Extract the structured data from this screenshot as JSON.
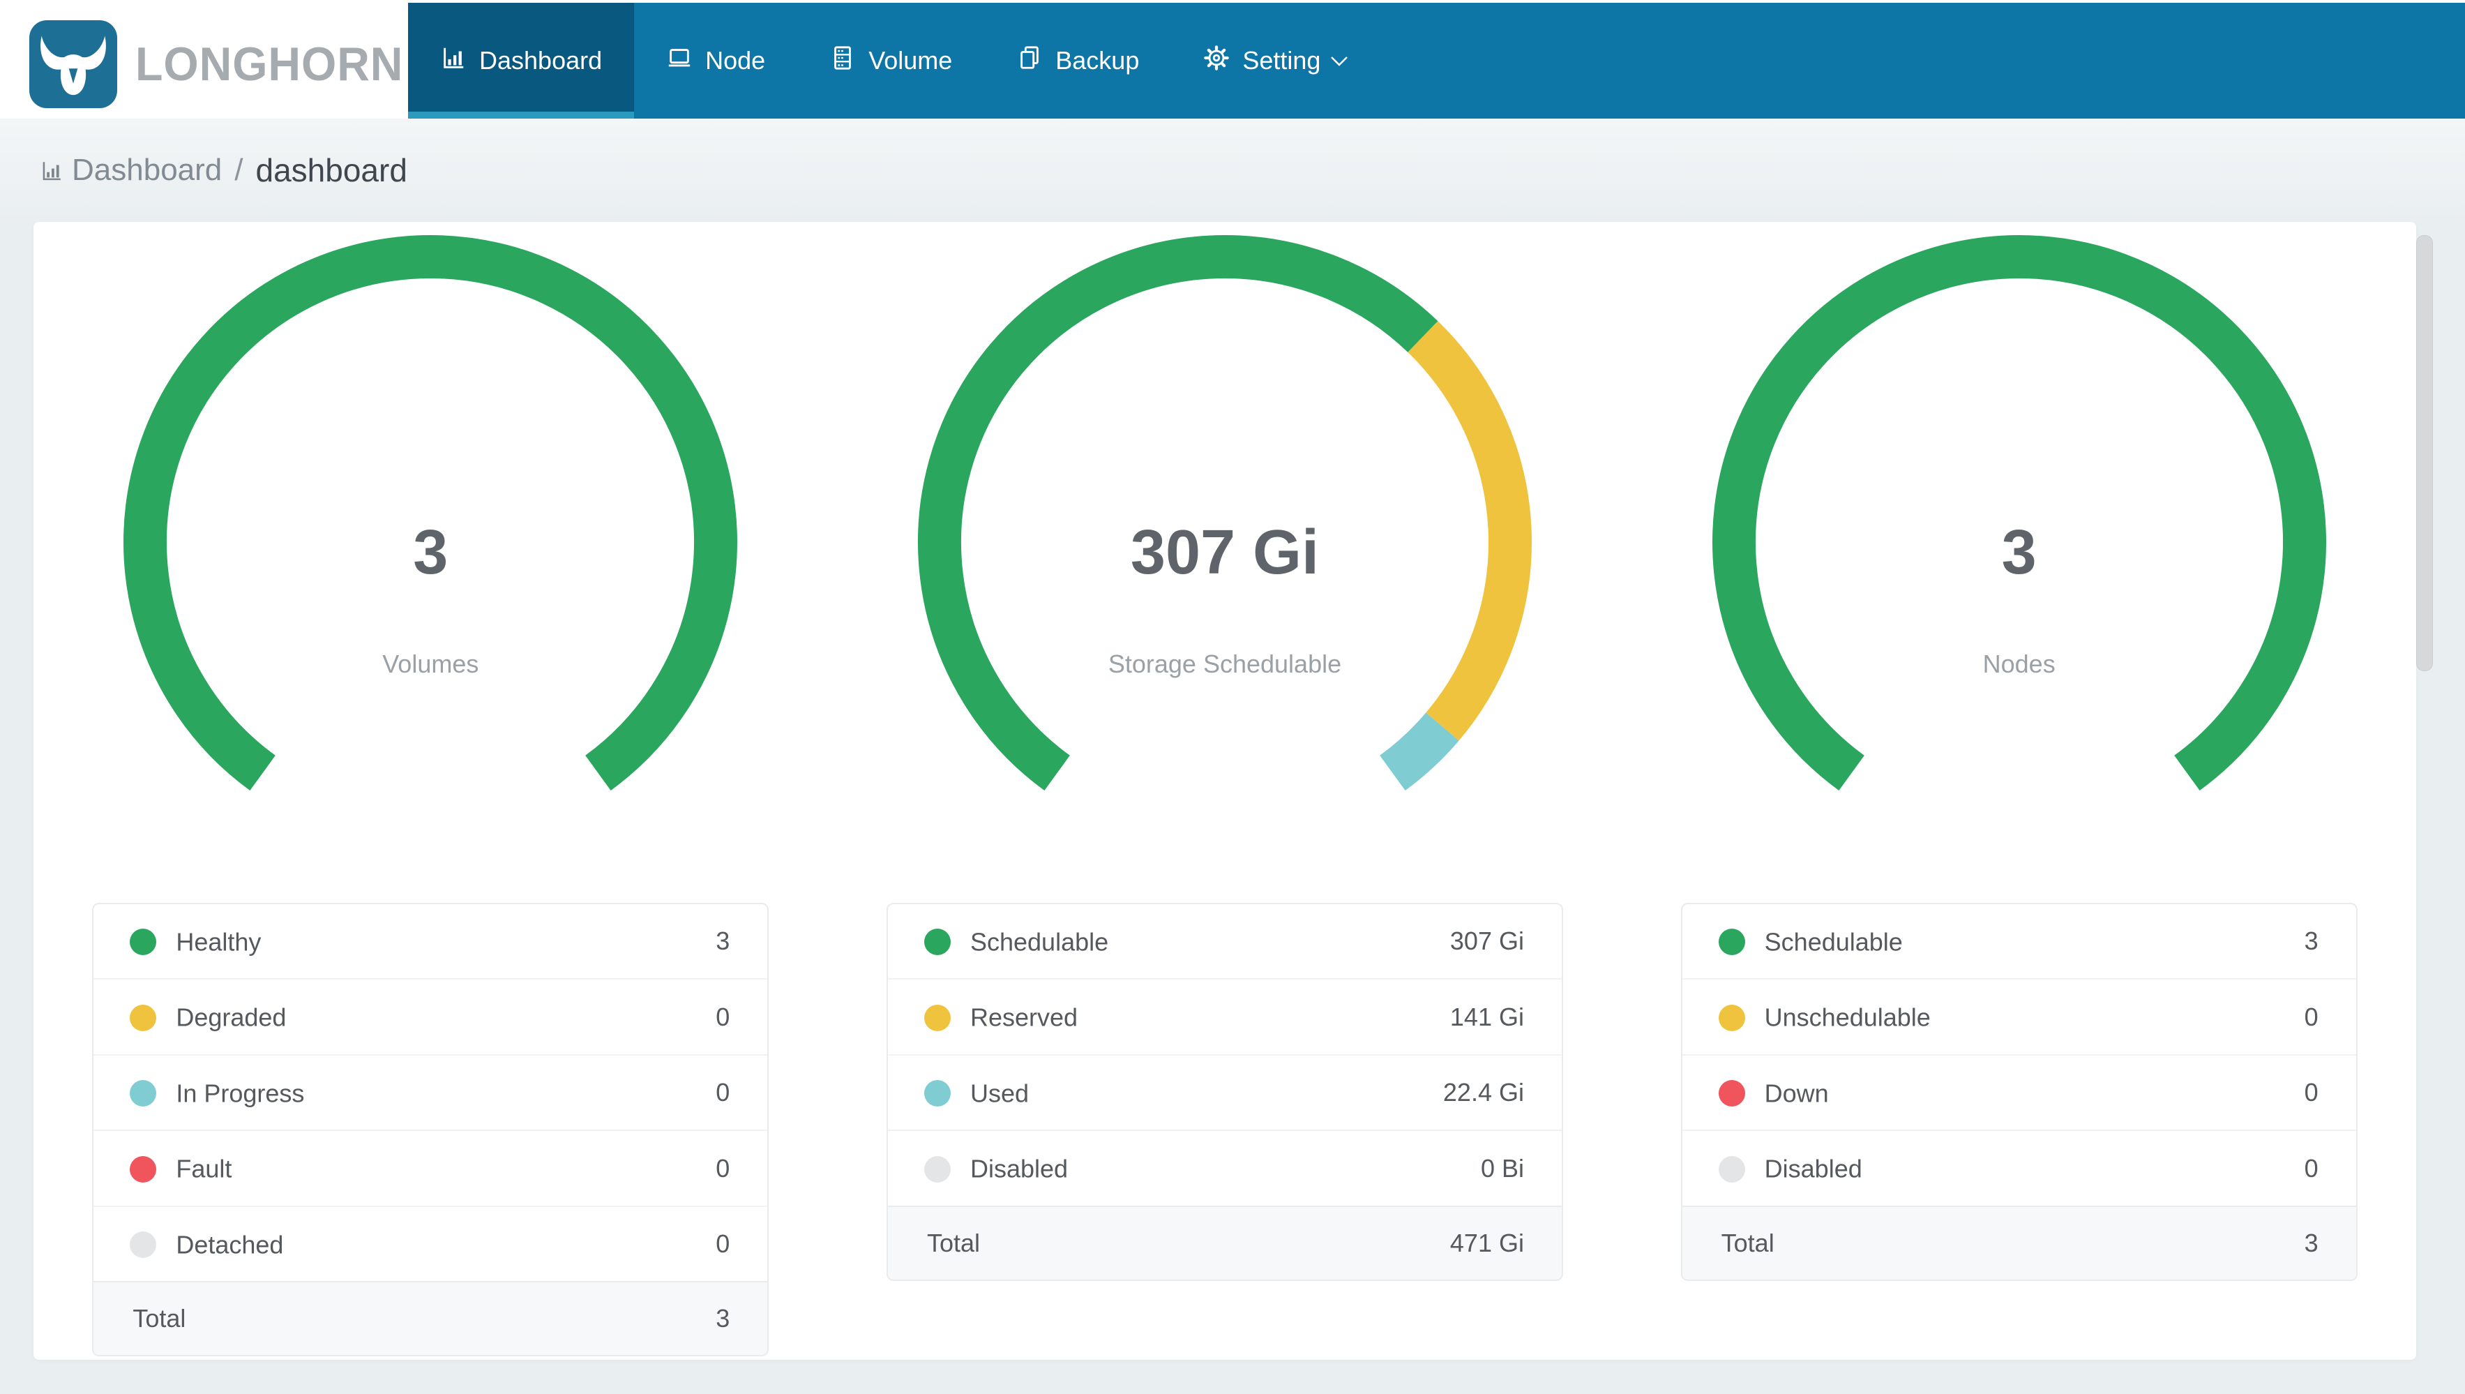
{
  "nav": {
    "brand": "LONGHORN",
    "items": [
      {
        "label": "Dashboard",
        "icon": "bar-chart-icon",
        "active": true
      },
      {
        "label": "Node",
        "icon": "node-icon",
        "active": false
      },
      {
        "label": "Volume",
        "icon": "volume-icon",
        "active": false
      },
      {
        "label": "Backup",
        "icon": "backup-icon",
        "active": false
      },
      {
        "label": "Setting",
        "icon": "gear-icon",
        "active": false,
        "has_dropdown": true
      }
    ]
  },
  "breadcrumb": {
    "root": "Dashboard",
    "separator": "/",
    "current": "dashboard"
  },
  "colors": {
    "navbar": "#0d76a6",
    "navbar_active": "#09587f",
    "active_underline": "#2b9abf",
    "logo_bg": "#1e6f96",
    "brand_text": "#a6abb0",
    "page_bg": "#e9eef0",
    "card_bg": "#ffffff",
    "green": "#2aa65f",
    "yellow": "#f0c33e",
    "teal": "#7fccd3",
    "red": "#f0545c",
    "gray": "#e3e5e7"
  },
  "chart_data": [
    {
      "type": "gauge",
      "center_value": "3",
      "center_label": "Volumes",
      "gauge": {
        "start_angle": 216,
        "sweep": 288
      },
      "segments": [
        {
          "label": "Healthy",
          "value": 3,
          "display": "3",
          "color": "#2aa65f"
        },
        {
          "label": "Degraded",
          "value": 0,
          "display": "0",
          "color": "#f0c33e"
        },
        {
          "label": "In Progress",
          "value": 0,
          "display": "0",
          "color": "#7fccd3"
        },
        {
          "label": "Fault",
          "value": 0,
          "display": "0",
          "color": "#f0545c"
        },
        {
          "label": "Detached",
          "value": 0,
          "display": "0",
          "color": "#e3e5e7"
        }
      ],
      "total": {
        "label": "Total",
        "display": "3"
      }
    },
    {
      "type": "gauge",
      "center_value": "307 Gi",
      "center_label": "Storage Schedulable",
      "gauge": {
        "start_angle": 216,
        "sweep": 288
      },
      "segments": [
        {
          "label": "Schedulable",
          "value": 307,
          "display": "307 Gi",
          "color": "#2aa65f"
        },
        {
          "label": "Reserved",
          "value": 141,
          "display": "141 Gi",
          "color": "#f0c33e"
        },
        {
          "label": "Used",
          "value": 22.4,
          "display": "22.4 Gi",
          "color": "#7fccd3"
        },
        {
          "label": "Disabled",
          "value": 0,
          "display": "0 Bi",
          "color": "#e3e5e7"
        }
      ],
      "total": {
        "label": "Total",
        "display": "471 Gi"
      }
    },
    {
      "type": "gauge",
      "center_value": "3",
      "center_label": "Nodes",
      "gauge": {
        "start_angle": 216,
        "sweep": 288
      },
      "segments": [
        {
          "label": "Schedulable",
          "value": 3,
          "display": "3",
          "color": "#2aa65f"
        },
        {
          "label": "Unschedulable",
          "value": 0,
          "display": "0",
          "color": "#f0c33e"
        },
        {
          "label": "Down",
          "value": 0,
          "display": "0",
          "color": "#f0545c"
        },
        {
          "label": "Disabled",
          "value": 0,
          "display": "0",
          "color": "#e3e5e7"
        }
      ],
      "total": {
        "label": "Total",
        "display": "3"
      }
    }
  ]
}
